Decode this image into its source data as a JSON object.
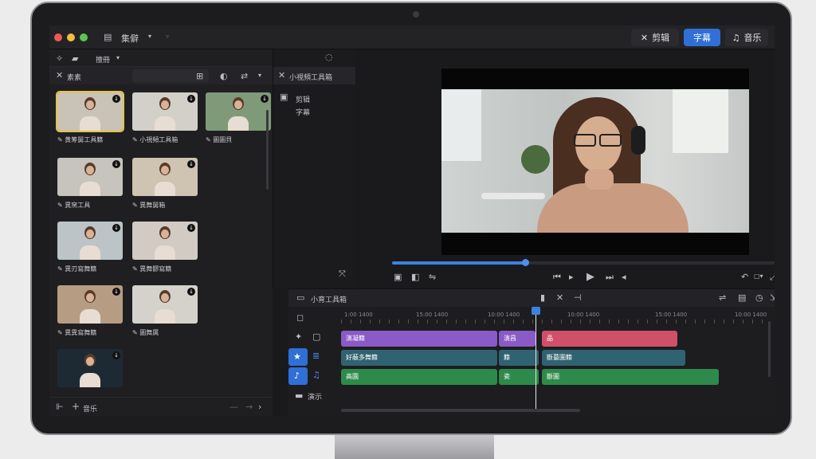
{
  "titlebar": {
    "project": "集僻",
    "modes": [
      {
        "label": "剪辑",
        "icon": "scissors-icon"
      },
      {
        "label": "字幕",
        "icon": ""
      },
      {
        "label": "音乐",
        "icon": "music-note-icon"
      }
    ]
  },
  "media_panel": {
    "sort_label": "擅冊",
    "tab_label": "素素",
    "thumbs": [
      {
        "caption": "黄筹舅工具籍",
        "selected": true
      },
      {
        "caption": "小視頻工具箱",
        "selected": false
      },
      {
        "caption": "圖圖貝",
        "selected": false
      },
      {
        "caption": "異窯工具",
        "selected": false
      },
      {
        "caption": "異舞舅箱",
        "selected": false
      },
      {
        "caption": "異刃寫舞籍",
        "selected": false
      },
      {
        "caption": "異舞髎寫籍",
        "selected": false
      },
      {
        "caption": "異異寫舞籍",
        "selected": false
      },
      {
        "caption": "圖舞属",
        "selected": false
      },
      {
        "caption": "",
        "selected": false
      }
    ],
    "add_label": "音乐"
  },
  "tools_panel": {
    "title": "小視頻工具箱",
    "items": [
      "剪辑",
      "字幕"
    ]
  },
  "player": {
    "progress": 0.34
  },
  "timeline": {
    "title": "小育工具箱",
    "ruler": [
      "1:00 1400",
      "15:00 1400",
      "10:00 1400",
      "10:00 1400",
      "15:00 1400",
      "10:00 1400"
    ],
    "tracks": {
      "text": [
        {
          "label": "演凝籍",
          "color": "#8a5ac7"
        },
        {
          "label": "演昌",
          "color": "#8a5ac7"
        },
        {
          "label": "品",
          "color": "#d0506a"
        }
      ],
      "video": [
        {
          "label": "好蔽多舞籍",
          "color": "#2f6370"
        },
        {
          "label": "籍",
          "color": "#2f6370"
        },
        {
          "label": "斷蕞圖籍",
          "color": "#2f6370"
        }
      ],
      "audio": [
        {
          "label": "高園",
          "color": "#2e8a4a"
        },
        {
          "label": "瓷",
          "color": "#2e8a4a"
        },
        {
          "label": "斷圖",
          "color": "#2e8a4a"
        }
      ]
    },
    "side_label": "演示"
  }
}
